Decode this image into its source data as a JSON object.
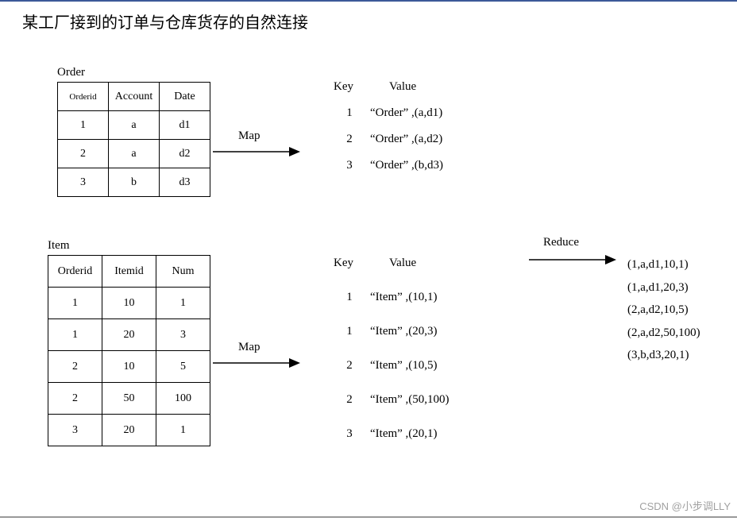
{
  "title": "某工厂接到的订单与仓库货存的自然连接",
  "order": {
    "label": "Order",
    "headers": [
      "Orderid",
      "Account",
      "Date"
    ],
    "rows": [
      [
        "1",
        "a",
        "d1"
      ],
      [
        "2",
        "a",
        "d2"
      ],
      [
        "3",
        "b",
        "d3"
      ]
    ]
  },
  "item": {
    "label": "Item",
    "headers": [
      "Orderid",
      "Itemid",
      "Num"
    ],
    "rows": [
      [
        "1",
        "10",
        "1"
      ],
      [
        "1",
        "20",
        "3"
      ],
      [
        "2",
        "10",
        "5"
      ],
      [
        "2",
        "50",
        "100"
      ],
      [
        "3",
        "20",
        "1"
      ]
    ]
  },
  "labels": {
    "map1": "Map",
    "map2": "Map",
    "reduce": "Reduce",
    "key": "Key",
    "value": "Value"
  },
  "order_kv": [
    {
      "k": "1",
      "v": "“Order” ,(a,d1)"
    },
    {
      "k": "2",
      "v": "“Order” ,(a,d2)"
    },
    {
      "k": "3",
      "v": "“Order” ,(b,d3)"
    }
  ],
  "item_kv": [
    {
      "k": "1",
      "v": "“Item” ,(10,1)"
    },
    {
      "k": "1",
      "v": "“Item” ,(20,3)"
    },
    {
      "k": "2",
      "v": "“Item” ,(10,5)"
    },
    {
      "k": "2",
      "v": "“Item” ,(50,100)"
    },
    {
      "k": "3",
      "v": "“Item” ,(20,1)"
    }
  ],
  "reduce_out": [
    "(1,a,d1,10,1)",
    "(1,a,d1,20,3)",
    "(2,a,d2,10,5)",
    "(2,a,d2,50,100)",
    "(3,b,d3,20,1)"
  ],
  "watermark": "CSDN @小步调LLY"
}
